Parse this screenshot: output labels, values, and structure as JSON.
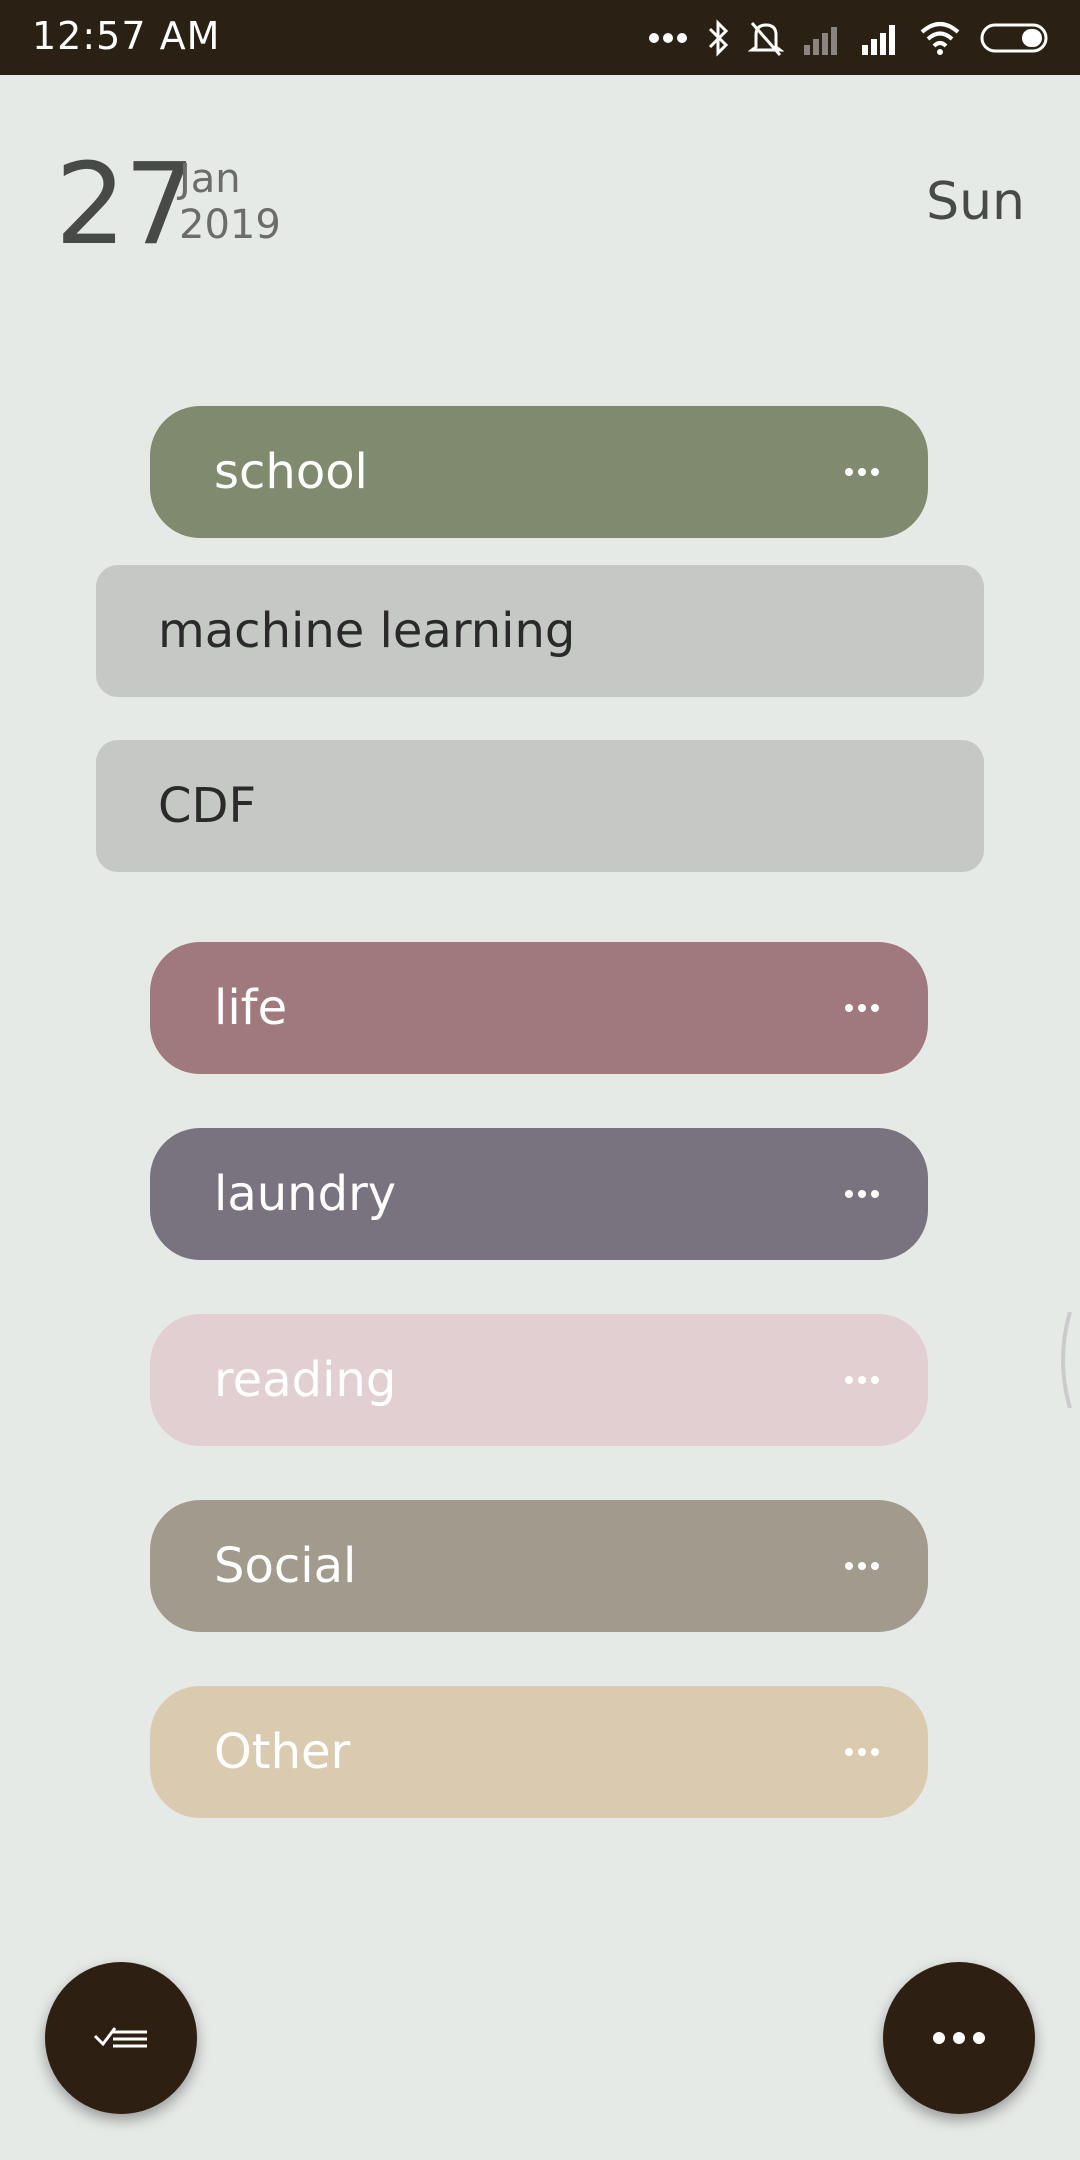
{
  "status_bar": {
    "time": "12:57  AM",
    "icons": [
      "more-dots-icon",
      "bluetooth-icon",
      "alarm-off-icon",
      "signal-weak-icon",
      "signal-icon",
      "wifi-icon",
      "battery-icon"
    ]
  },
  "header": {
    "day": "27",
    "month": "Jan",
    "year": "2019",
    "weekday": "Sun"
  },
  "categories": [
    {
      "label": "school",
      "color": "#7f8a6e"
    },
    {
      "label": "life",
      "color": "#9f797c"
    },
    {
      "label": "laundry",
      "color": "#79737f"
    },
    {
      "label": "reading",
      "color": "#e1cfd2"
    },
    {
      "label": "Social",
      "color": "#a39a8e"
    },
    {
      "label": "Other",
      "color": "#dacab0"
    }
  ],
  "subitems": [
    {
      "label": "machine learning"
    },
    {
      "label": "CDF"
    }
  ],
  "fab": {
    "left_icon": "checklist-icon",
    "right_icon": "more-icon"
  },
  "colors": {
    "background": "#e6eae7",
    "statusbar": "#2b2014",
    "fab": "#2d1f12",
    "subitem": "#c6c8c5"
  }
}
